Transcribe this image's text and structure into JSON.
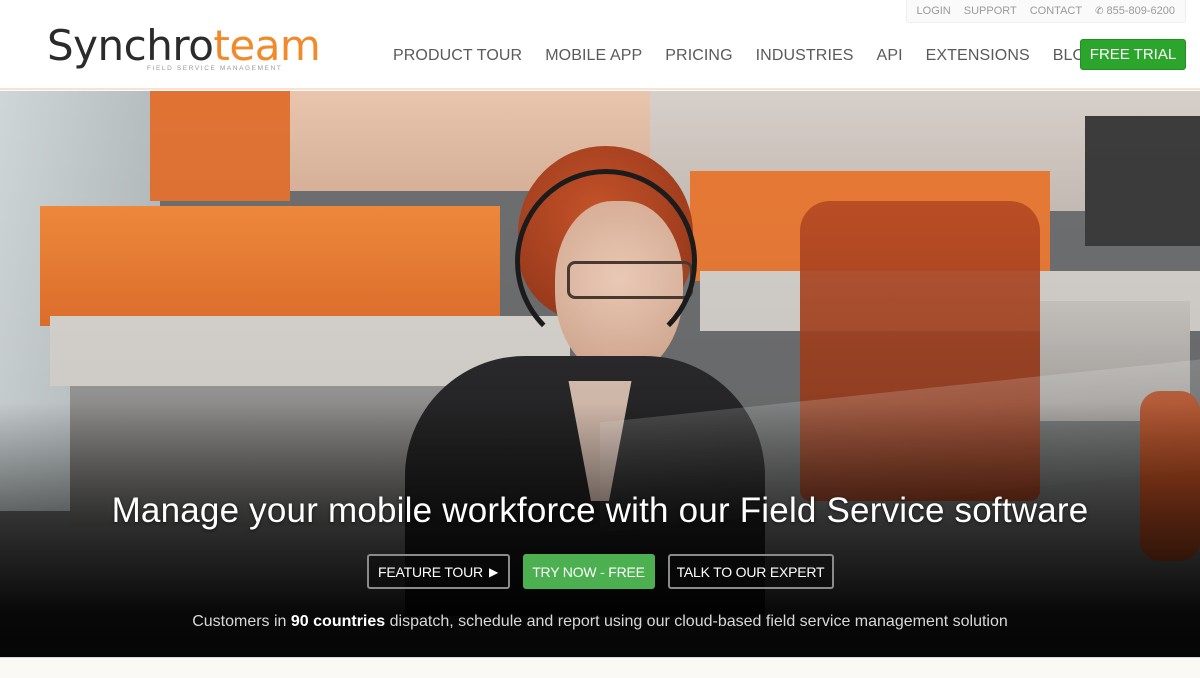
{
  "topbar": {
    "login": "LOGIN",
    "support": "SUPPORT",
    "contact": "CONTACT",
    "phone_icon": "phone-icon",
    "phone": "855-809-6200"
  },
  "logo": {
    "part1": "Synchro",
    "part2": "team",
    "tagline": "FIELD SERVICE MANAGEMENT"
  },
  "nav": {
    "items": [
      {
        "label": "PRODUCT TOUR"
      },
      {
        "label": "MOBILE APP"
      },
      {
        "label": "PRICING"
      },
      {
        "label": "INDUSTRIES"
      },
      {
        "label": "API"
      },
      {
        "label": "EXTENSIONS"
      },
      {
        "label": "BLOG"
      }
    ],
    "cta": "FREE TRIAL"
  },
  "colors": {
    "brand_orange": "#f08a2b",
    "cta_green": "#2ca52c",
    "try_green": "#4caf50"
  },
  "hero": {
    "image_alt": "Woman wearing a headset in an orange office",
    "headline": "Manage your mobile workforce with our Field Service software",
    "buttons": {
      "feature_tour": "FEATURE TOUR",
      "feature_tour_icon": "play-icon",
      "try_now": "TRY NOW - FREE",
      "talk_expert": "TALK TO OUR EXPERT"
    },
    "subline": {
      "prefix": "Customers in",
      "highlight": "90 countries",
      "suffix": "dispatch, schedule and report using our cloud-based field service management solution"
    }
  }
}
